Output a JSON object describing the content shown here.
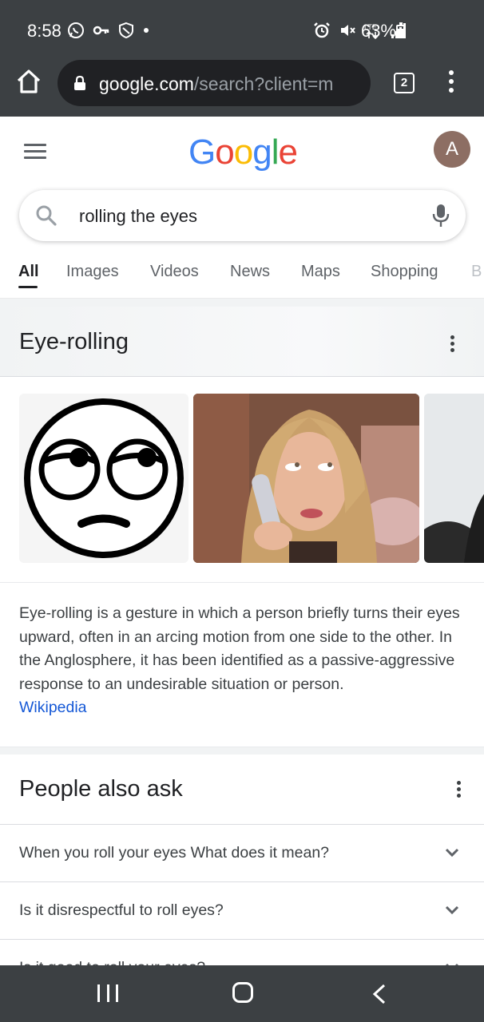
{
  "status_bar": {
    "time": "8:58",
    "battery": "63%",
    "network": "LTE"
  },
  "browser": {
    "url_domain": "google.com",
    "url_path": "/search?client=m",
    "tab_count": "2"
  },
  "header": {
    "logo_letters": [
      "G",
      "o",
      "o",
      "g",
      "l",
      "e"
    ],
    "logo_colors": [
      "#4285F4",
      "#EA4335",
      "#FBBC05",
      "#4285F4",
      "#34A853",
      "#EA4335"
    ],
    "avatar_letter": "A"
  },
  "search": {
    "query": "rolling the eyes"
  },
  "tabs": [
    {
      "label": "All",
      "active": true
    },
    {
      "label": "Images"
    },
    {
      "label": "Videos"
    },
    {
      "label": "News"
    },
    {
      "label": "Maps"
    },
    {
      "label": "Shopping"
    },
    {
      "label": "B"
    }
  ],
  "knowledge_panel": {
    "title": "Eye-rolling",
    "description": "Eye-rolling is a gesture in which a person briefly turns their eyes upward, often in an arcing motion from one side to the other. In the Anglosphere, it has been identified as a passive-aggressive response to an undesirable situation or person.",
    "source_link": "Wikipedia"
  },
  "people_also_ask": {
    "title": "People also ask",
    "questions": [
      "When you roll your eyes What does it mean?",
      "Is it disrespectful to roll eyes?",
      "Is it good to roll your eyes?"
    ]
  },
  "colors": {
    "chrome_dark": "#3c4043",
    "link_blue": "#1558d6",
    "avatar_brown": "#8d6e63"
  }
}
